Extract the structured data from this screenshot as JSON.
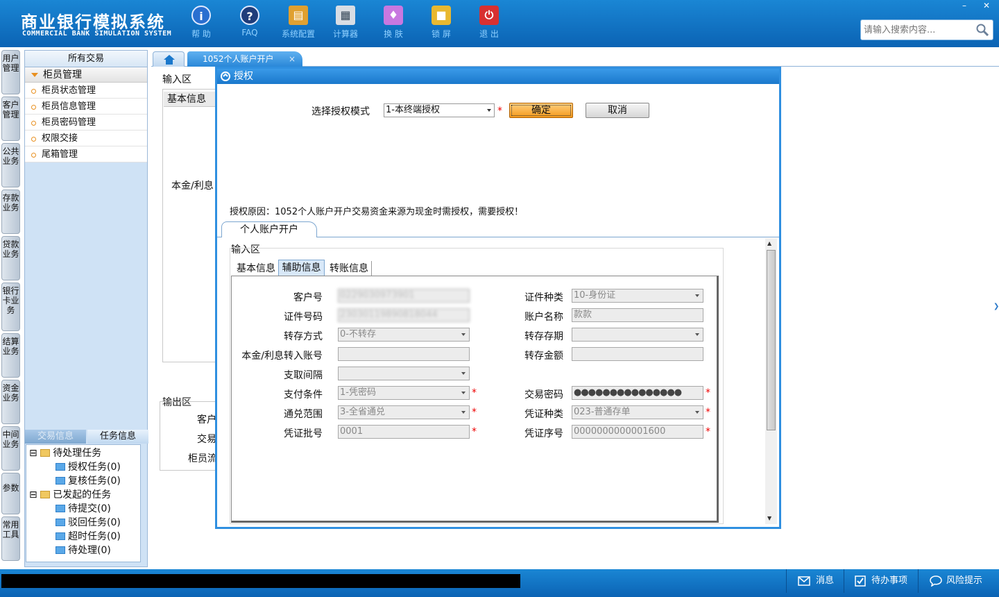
{
  "header": {
    "app_title_cn": "商业银行模拟系统",
    "app_title_en": "COMMERCIAL BANK SIMULATION SYSTEM",
    "toolbar": [
      {
        "label": "帮 助",
        "icon": "info-icon"
      },
      {
        "label": "FAQ",
        "icon": "question-icon"
      },
      {
        "label": "系统配置",
        "icon": "toolbox-icon"
      },
      {
        "label": "计算器",
        "icon": "calculator-icon"
      },
      {
        "label": "换 肤",
        "icon": "shirt-icon"
      },
      {
        "label": "锁 屏",
        "icon": "lock-icon"
      },
      {
        "label": "退 出",
        "icon": "power-icon"
      }
    ],
    "window_controls": {
      "minimize": "–",
      "close": "✕"
    },
    "search_placeholder": "请输入搜索内容..."
  },
  "left_vertical_tabs": [
    "用户管理",
    "客户管理",
    "公共业务",
    "存款业务",
    "贷款业务",
    "银行卡业务",
    "结算业务",
    "资金业务",
    "中间业务",
    "参数",
    "常用工具"
  ],
  "sidebar": {
    "header": "所有交易",
    "group": "柜员管理",
    "items": [
      "柜员状态管理",
      "柜员信息管理",
      "柜员密码管理",
      "权限交接",
      "尾箱管理"
    ],
    "bottom_tabs": [
      "交易信息",
      "任务信息"
    ],
    "tree": {
      "pending": "待处理任务",
      "pending_children": [
        "授权任务(0)",
        "复核任务(0)"
      ],
      "initiated": "已发起的任务",
      "initiated_children": [
        "待提交(0)",
        "驳回任务(0)",
        "超时任务(0)",
        "待处理(0)"
      ]
    }
  },
  "tabs": {
    "home_icon": "home-icon",
    "active": "1052个人账户开户",
    "close": "×"
  },
  "background_form": {
    "input_area": "输入区",
    "basic_tab": "基本信息",
    "principal_label": "本金/利息",
    "output_area": "输出区",
    "out_labels": [
      "客户",
      "交易",
      "柜员流"
    ]
  },
  "dialog": {
    "title": "授权",
    "mode_label": "选择授权模式",
    "mode_value": "1-本终端授权",
    "confirm": "确定",
    "cancel": "取消",
    "reason": "授权原因：1052个人账户开户交易资金来源为现金时需授权，需要授权！",
    "inner_tab": "个人账户开户",
    "input_area": "输入区",
    "subtabs": [
      "基本信息",
      "辅助信息",
      "转账信息"
    ],
    "fields_left": [
      {
        "label": "客户号",
        "value": "0229030973901",
        "type": "text",
        "blurred": true
      },
      {
        "label": "证件号码",
        "value": "23030119890818044",
        "type": "text",
        "blurred": true
      },
      {
        "label": "转存方式",
        "value": "0-不转存",
        "type": "select"
      },
      {
        "label": "本金/利息转入账号",
        "value": "",
        "type": "text"
      },
      {
        "label": "支取间隔",
        "value": "",
        "type": "select"
      },
      {
        "label": "支付条件",
        "value": "1-凭密码",
        "type": "select",
        "required": true
      },
      {
        "label": "通兑范围",
        "value": "3-全省通兑",
        "type": "select",
        "required": true
      },
      {
        "label": "凭证批号",
        "value": "0001",
        "type": "text",
        "required": true
      }
    ],
    "fields_right": [
      {
        "label": "证件种类",
        "value": "10-身份证",
        "type": "select"
      },
      {
        "label": "账户名称",
        "value": "款款",
        "type": "text"
      },
      {
        "label": "转存存期",
        "value": "",
        "type": "select"
      },
      {
        "label": "转存金额",
        "value": "",
        "type": "text"
      },
      {
        "label": "交易密码",
        "value": "●●●●●●●●●●●●●●●",
        "type": "text",
        "required": true
      },
      {
        "label": "凭证种类",
        "value": "023-普通存单",
        "type": "select",
        "required": true
      },
      {
        "label": "凭证序号",
        "value": "0000000000001600",
        "type": "text",
        "required": true
      }
    ],
    "required_mark": "*"
  },
  "statusbar": {
    "items": [
      "消息",
      "待办事项",
      "风险提示"
    ]
  }
}
